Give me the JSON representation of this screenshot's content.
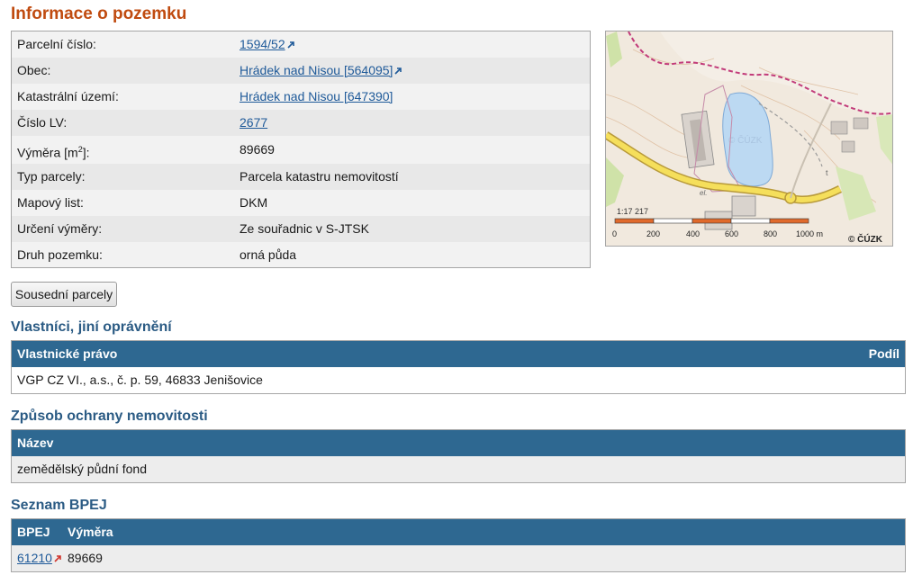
{
  "page_title": "Informace o pozemku",
  "info": {
    "rows": [
      {
        "label": "Parcelní číslo:",
        "value": "1594/52",
        "link": true,
        "ext": true
      },
      {
        "label": "Obec:",
        "value": "Hrádek nad Nisou [564095]",
        "link": true,
        "ext": true
      },
      {
        "label": "Katastrální území:",
        "value": "Hrádek nad Nisou [647390]",
        "link": true,
        "ext": false
      },
      {
        "label": "Číslo LV:",
        "value": "2677",
        "link": true,
        "ext": false
      },
      {
        "label_prefix": "Výměra [m",
        "label_sup": "2",
        "label_suffix": "]:",
        "value": "89669"
      },
      {
        "label": "Typ parcely:",
        "value": "Parcela katastru nemovitostí"
      },
      {
        "label": "Mapový list:",
        "value": "DKM"
      },
      {
        "label": "Určení výměry:",
        "value": "Ze souřadnic v S-JTSK"
      },
      {
        "label": "Druh pozemku:",
        "value": "orná půda"
      }
    ]
  },
  "map": {
    "scale_label": "1:17 217",
    "ticks": [
      "0",
      "200",
      "400",
      "600",
      "800",
      "1000 m"
    ],
    "copyright": "© ČÚZK",
    "watermark": "© ČÚZK"
  },
  "neighbors_button": "Sousední parcely",
  "owners": {
    "title": "Vlastníci, jiní oprávnění",
    "col_right": "Podíl",
    "col_left": "Vlastnické právo",
    "rows": [
      {
        "name": "VGP CZ VI., a.s., č. p. 59, 46833 Jenišovice"
      }
    ]
  },
  "protection": {
    "title": "Způsob ochrany nemovitosti",
    "col": "Název",
    "rows": [
      {
        "name": "zemědělský půdní fond"
      }
    ]
  },
  "bpej": {
    "title": "Seznam BPEJ",
    "col_code": "BPEJ",
    "col_area": "Výměra",
    "rows": [
      {
        "code": "61210",
        "area": "89669"
      }
    ]
  },
  "colors": {
    "title": "#c04b10",
    "section": "#2b5b84",
    "table_header": "#2e6891",
    "link": "#1f5a99"
  }
}
